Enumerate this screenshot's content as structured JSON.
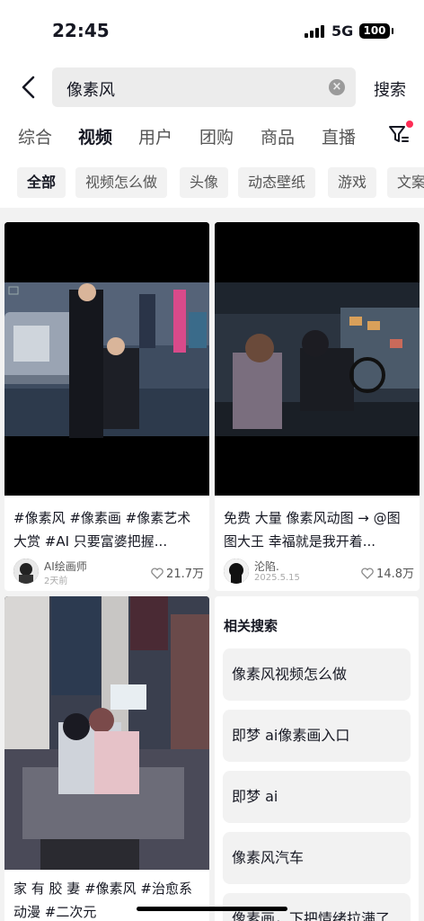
{
  "status_bar": {
    "time": "22:45",
    "network": "5G",
    "battery": "100"
  },
  "search": {
    "query": "像素风",
    "button_label": "搜索"
  },
  "tabs": [
    {
      "label": "综合"
    },
    {
      "label": "视频"
    },
    {
      "label": "用户"
    },
    {
      "label": "团购"
    },
    {
      "label": "商品"
    },
    {
      "label": "直播"
    }
  ],
  "active_tab": "视频",
  "chips": [
    {
      "label": "全部"
    },
    {
      "label": "视频怎么做"
    },
    {
      "label": "头像"
    },
    {
      "label": "动态壁纸"
    },
    {
      "label": "游戏"
    },
    {
      "label": "文案"
    }
  ],
  "videos": [
    {
      "title": "#像素风 #像素画 #像素艺术大赏 #AI  只要富婆把握...",
      "author": "AI绘画师",
      "date": "2天前",
      "likes": "21.7万"
    },
    {
      "title": "免费 大量 像素风动图 → @图图大王 幸福就是我开着...",
      "author": "沦陷.",
      "date": "2025.5.15",
      "likes": "14.8万"
    },
    {
      "title": "家 有 胶 妻 #像素风 #治愈系动漫 #二次元"
    }
  ],
  "related": {
    "heading": "相关搜索",
    "items": [
      "像素风视频怎么做",
      "即梦 ai像素画入口",
      "即梦 ai",
      "像素风汽车",
      "像素画，下把情绪拉满了"
    ]
  },
  "colors": {
    "accent": "#fe2c55",
    "background": "#f2f2f2"
  }
}
